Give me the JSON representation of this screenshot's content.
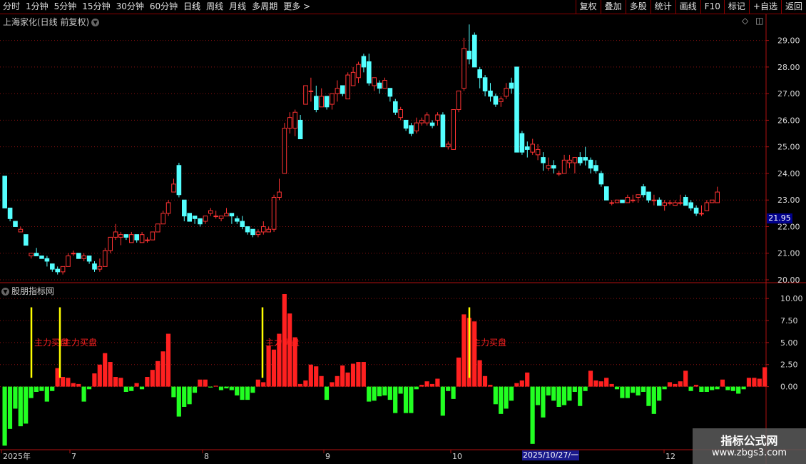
{
  "toolbar": {
    "periods": [
      "分时",
      "1分钟",
      "5分钟",
      "15分钟",
      "30分钟",
      "60分钟",
      "日线",
      "周线",
      "月线",
      "多周期",
      "更多 >"
    ],
    "active_period": "日线",
    "buttons": [
      "复权",
      "叠加",
      "多股",
      "统计",
      "画线",
      "F10",
      "标记",
      "+自选",
      "返回"
    ]
  },
  "main_pane": {
    "title": "上海家化(日线 前复权)",
    "current_price": "21.95"
  },
  "indicator_pane": {
    "title": "股朋指标网"
  },
  "time_axis": {
    "labels": [
      "2025年",
      "7",
      "8",
      "9",
      "10",
      "12"
    ],
    "cursor_date": "2025/10/27/一"
  },
  "watermark": {
    "title": "指标公式网",
    "url": "www.zbgs3.com"
  },
  "colors": {
    "up": "#ff3333",
    "down": "#54ffff",
    "bar_pos": "#ff2020",
    "bar_neg": "#22ff22",
    "signal": "#ffff00",
    "grid": "#8b1010"
  },
  "chart_data": [
    {
      "type": "candlestick",
      "title": "上海家化(日线 前复权)",
      "ylim": [
        20.0,
        29.5
      ],
      "y_ticks": [
        "29.00",
        "28.00",
        "27.00",
        "26.00",
        "25.00",
        "24.00",
        "23.00",
        "22.00",
        "21.00",
        "20.00"
      ],
      "ohlc": [
        [
          23.9,
          23.9,
          22.7,
          22.7
        ],
        [
          22.7,
          22.7,
          22.2,
          22.3
        ],
        [
          22.2,
          22.2,
          22.0,
          22.0
        ],
        [
          21.8,
          22.0,
          21.8,
          21.9
        ],
        [
          21.7,
          21.7,
          21.3,
          21.3
        ],
        [
          20.9,
          21.0,
          20.8,
          21.0
        ],
        [
          21.0,
          21.2,
          20.9,
          20.9
        ],
        [
          20.9,
          20.9,
          20.8,
          20.8
        ],
        [
          20.8,
          20.9,
          20.5,
          20.7
        ],
        [
          20.6,
          20.6,
          20.3,
          20.4
        ],
        [
          20.4,
          20.5,
          20.2,
          20.3
        ],
        [
          20.3,
          20.5,
          20.2,
          20.5
        ],
        [
          20.5,
          21.0,
          20.5,
          20.9
        ],
        [
          21.0,
          21.1,
          20.9,
          21.0
        ],
        [
          21.0,
          21.0,
          20.8,
          20.8
        ],
        [
          20.8,
          21.0,
          20.7,
          20.9
        ],
        [
          20.9,
          20.9,
          20.6,
          20.7
        ],
        [
          20.6,
          20.7,
          20.3,
          20.4
        ],
        [
          20.4,
          20.8,
          20.3,
          20.5
        ],
        [
          20.5,
          21.2,
          20.5,
          21.1
        ],
        [
          21.1,
          21.6,
          21.0,
          21.6
        ],
        [
          21.6,
          22.1,
          21.5,
          21.8
        ],
        [
          21.6,
          21.8,
          21.3,
          21.7
        ],
        [
          21.7,
          21.7,
          21.5,
          21.6
        ],
        [
          21.4,
          21.8,
          21.4,
          21.7
        ],
        [
          21.7,
          21.7,
          21.4,
          21.5
        ],
        [
          21.4,
          21.8,
          21.4,
          21.7
        ],
        [
          21.5,
          21.6,
          21.4,
          21.5
        ],
        [
          21.5,
          21.8,
          21.5,
          21.8
        ],
        [
          21.8,
          22.1,
          21.8,
          22.1
        ],
        [
          22.1,
          22.6,
          22.1,
          22.5
        ],
        [
          22.5,
          23.0,
          22.4,
          22.9
        ],
        [
          23.3,
          23.8,
          23.3,
          23.6
        ],
        [
          24.3,
          24.4,
          23.1,
          23.2
        ],
        [
          23.0,
          23.0,
          22.2,
          22.4
        ],
        [
          22.5,
          22.5,
          22.2,
          22.2
        ],
        [
          22.4,
          22.4,
          22.1,
          22.3
        ],
        [
          22.3,
          22.3,
          22.0,
          22.1
        ],
        [
          22.2,
          22.4,
          22.1,
          22.4
        ],
        [
          22.5,
          22.7,
          22.4,
          22.6
        ],
        [
          22.4,
          22.6,
          22.3,
          22.4
        ],
        [
          22.3,
          22.4,
          22.2,
          22.4
        ],
        [
          22.4,
          22.7,
          22.4,
          22.5
        ],
        [
          22.5,
          22.5,
          22.1,
          22.4
        ],
        [
          22.3,
          22.4,
          22.1,
          22.2
        ],
        [
          22.2,
          22.4,
          21.9,
          22.0
        ],
        [
          22.0,
          22.0,
          21.7,
          21.8
        ],
        [
          21.9,
          21.9,
          21.6,
          21.7
        ],
        [
          21.7,
          21.9,
          21.6,
          21.8
        ],
        [
          21.8,
          22.2,
          21.7,
          22.0
        ],
        [
          21.8,
          22.0,
          21.8,
          21.9
        ],
        [
          21.9,
          23.2,
          21.8,
          23.1
        ],
        [
          23.1,
          23.8,
          23.0,
          23.3
        ],
        [
          24.0,
          25.9,
          24.0,
          25.7
        ],
        [
          25.7,
          26.3,
          25.5,
          26.1
        ],
        [
          25.7,
          26.4,
          25.4,
          26.3
        ],
        [
          26.0,
          26.2,
          25.3,
          25.3
        ],
        [
          26.6,
          27.3,
          26.6,
          27.3
        ],
        [
          27.1,
          27.6,
          26.7,
          27.1
        ],
        [
          26.9,
          27.3,
          26.3,
          26.4
        ],
        [
          26.5,
          27.2,
          26.5,
          26.9
        ],
        [
          26.9,
          26.9,
          26.4,
          26.5
        ],
        [
          26.6,
          27.0,
          26.4,
          27.0
        ],
        [
          27.0,
          27.5,
          26.7,
          27.2
        ],
        [
          27.3,
          27.3,
          26.9,
          27.0
        ],
        [
          26.8,
          27.8,
          26.8,
          27.7
        ],
        [
          27.3,
          28.0,
          27.3,
          27.8
        ],
        [
          27.6,
          28.2,
          27.4,
          28.1
        ],
        [
          28.4,
          28.5,
          27.8,
          28.0
        ],
        [
          28.2,
          28.5,
          27.3,
          27.4
        ],
        [
          27.3,
          27.6,
          27.1,
          27.6
        ],
        [
          27.4,
          27.5,
          27.0,
          27.2
        ],
        [
          27.2,
          27.6,
          27.2,
          27.5
        ],
        [
          27.2,
          27.2,
          26.7,
          26.9
        ],
        [
          26.7,
          26.8,
          26.2,
          26.3
        ],
        [
          26.1,
          26.5,
          26.0,
          26.4
        ],
        [
          26.0,
          26.0,
          25.6,
          25.7
        ],
        [
          25.8,
          25.9,
          25.4,
          25.5
        ],
        [
          25.6,
          26.1,
          25.5,
          25.9
        ],
        [
          25.9,
          26.1,
          25.8,
          26.0
        ],
        [
          25.9,
          26.3,
          25.8,
          26.2
        ],
        [
          25.9,
          26.0,
          25.7,
          25.8
        ],
        [
          26.0,
          26.3,
          25.8,
          26.2
        ],
        [
          26.2,
          26.3,
          25.0,
          25.0
        ],
        [
          25.0,
          25.2,
          24.9,
          25.1
        ],
        [
          24.9,
          26.4,
          24.9,
          26.4
        ],
        [
          26.4,
          27.1,
          26.3,
          27.1
        ],
        [
          27.2,
          29.1,
          27.1,
          28.7
        ],
        [
          28.6,
          29.6,
          28.1,
          28.3
        ],
        [
          29.2,
          29.3,
          28.0,
          28.0
        ],
        [
          27.9,
          28.0,
          27.2,
          27.6
        ],
        [
          27.6,
          27.7,
          26.9,
          27.1
        ],
        [
          27.1,
          27.4,
          26.7,
          26.9
        ],
        [
          26.9,
          27.0,
          26.5,
          26.6
        ],
        [
          26.7,
          26.9,
          26.5,
          26.8
        ],
        [
          26.9,
          27.4,
          26.8,
          27.2
        ],
        [
          27.4,
          27.6,
          27.0,
          27.2
        ],
        [
          28.0,
          28.0,
          24.8,
          24.8
        ],
        [
          25.5,
          25.6,
          24.7,
          24.8
        ],
        [
          25.0,
          25.2,
          24.6,
          24.9
        ],
        [
          24.8,
          25.3,
          24.7,
          25.1
        ],
        [
          24.7,
          25.1,
          24.5,
          24.9
        ],
        [
          24.6,
          24.8,
          24.1,
          24.4
        ],
        [
          24.2,
          24.6,
          24.1,
          24.3
        ],
        [
          24.3,
          24.5,
          24.0,
          24.2
        ],
        [
          24.0,
          24.1,
          23.9,
          24.0
        ],
        [
          24.0,
          24.7,
          24.0,
          24.5
        ],
        [
          24.4,
          24.7,
          24.2,
          24.5
        ],
        [
          24.4,
          24.5,
          24.0,
          24.6
        ],
        [
          24.6,
          24.8,
          24.3,
          24.4
        ],
        [
          24.6,
          25.0,
          24.3,
          24.5
        ],
        [
          24.5,
          24.6,
          24.0,
          24.2
        ],
        [
          24.3,
          24.5,
          24.0,
          24.1
        ],
        [
          24.0,
          24.1,
          23.5,
          23.6
        ],
        [
          23.5,
          23.5,
          23.0,
          23.0
        ],
        [
          22.9,
          23.0,
          22.8,
          22.9
        ],
        [
          22.9,
          23.0,
          22.9,
          23.0
        ],
        [
          23.0,
          23.0,
          22.9,
          22.9
        ],
        [
          22.9,
          23.2,
          22.9,
          23.1
        ],
        [
          23.0,
          23.2,
          22.9,
          23.0
        ],
        [
          23.1,
          23.2,
          22.9,
          23.2
        ],
        [
          23.5,
          23.6,
          23.1,
          23.2
        ],
        [
          23.3,
          23.3,
          22.9,
          23.0
        ],
        [
          23.0,
          23.2,
          22.8,
          23.0
        ],
        [
          23.0,
          23.1,
          22.9,
          22.8
        ],
        [
          22.8,
          23.0,
          22.6,
          22.9
        ],
        [
          22.9,
          23.0,
          22.8,
          22.9
        ],
        [
          22.8,
          23.0,
          22.8,
          22.9
        ],
        [
          22.9,
          23.2,
          22.8,
          22.9
        ],
        [
          23.1,
          23.2,
          22.8,
          22.8
        ],
        [
          22.9,
          23.0,
          22.6,
          22.7
        ],
        [
          22.7,
          22.8,
          22.4,
          22.5
        ],
        [
          22.5,
          22.8,
          22.4,
          22.5
        ],
        [
          22.6,
          23.0,
          22.6,
          22.9
        ],
        [
          22.9,
          23.0,
          22.9,
          23.0
        ],
        [
          22.9,
          23.5,
          22.9,
          23.3
        ]
      ]
    },
    {
      "type": "bar",
      "title": "股朋指标网",
      "ylim": [
        -7,
        10.5
      ],
      "y_ticks": [
        "10.00",
        "7.50",
        "5.00",
        "2.50",
        "0.00"
      ],
      "values": [
        -6.7,
        -4.8,
        -2.5,
        -4.5,
        -4.2,
        -1.3,
        -0.6,
        -0.5,
        -1.7,
        -0.5,
        2.1,
        1.1,
        1.0,
        0.4,
        0.3,
        -1.7,
        -0.3,
        1.5,
        2.5,
        3.8,
        2.8,
        1.1,
        1.0,
        -0.6,
        -0.5,
        0.4,
        -0.3,
        1.1,
        1.9,
        2.9,
        4.0,
        6.0,
        -1.2,
        -3.4,
        -2.3,
        -2.0,
        -0.7,
        0.8,
        0.8,
        -0.1,
        0.1,
        -0.4,
        -0.2,
        -0.4,
        -1.0,
        -1.5,
        -1.5,
        -0.7,
        0.8,
        0.5,
        4.6,
        4.2,
        6.0,
        10.5,
        8.3,
        5.6,
        0.3,
        0.7,
        2.5,
        2.3,
        1.2,
        -1.5,
        0.5,
        1.2,
        2.4,
        1.6,
        2.6,
        2.8,
        2.8,
        -1.7,
        -1.6,
        -1.1,
        -1.0,
        -1.5,
        -3.0,
        -0.8,
        -3.0,
        -3.0,
        -0.3,
        0.2,
        0.6,
        0.3,
        0.9,
        -3.3,
        -0.5,
        -1.4,
        3.3,
        8.2,
        7.8,
        7.4,
        3.0,
        1.2,
        0.2,
        -2.0,
        -3.1,
        -2.5,
        -1.6,
        0.4,
        0.7,
        1.6,
        -6.5,
        -2.1,
        -3.5,
        -1.0,
        -1.6,
        -2.3,
        -2.1,
        -1.6,
        -0.6,
        -2.2,
        -0.5,
        1.8,
        0.7,
        0.6,
        1.0,
        0.3,
        -0.3,
        -1.3,
        -1.3,
        -0.7,
        -1.0,
        -0.6,
        -2.2,
        -3.1,
        -1.6,
        -0.3,
        0.5,
        0.3,
        0.6,
        1.8,
        -0.5,
        0.2,
        -0.6,
        -0.6,
        -0.4,
        -0.3,
        0.8,
        -0.4,
        -0.5,
        -0.8,
        -0.3,
        1.0,
        1.0,
        0.9,
        2.2
      ],
      "signals": [
        {
          "label": "主力买盘"
        },
        {
          "label": "主力买盘"
        },
        {
          "label": "主力买盘"
        },
        {
          "label": "主力买盘"
        }
      ]
    }
  ]
}
